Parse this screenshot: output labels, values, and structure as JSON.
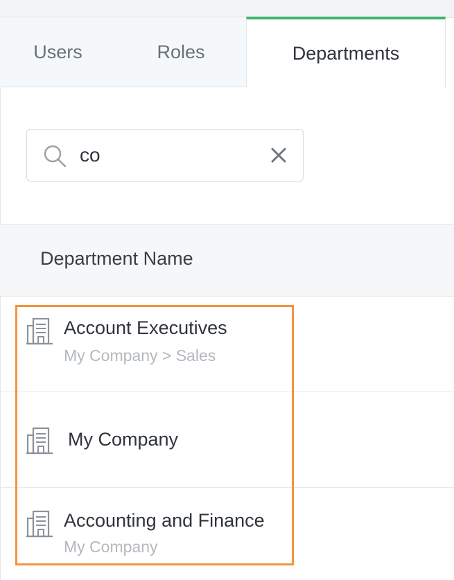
{
  "tabs": [
    {
      "label": "Users",
      "active": false
    },
    {
      "label": "Roles",
      "active": false
    },
    {
      "label": "Departments",
      "active": true
    }
  ],
  "search": {
    "value": "co",
    "placeholder": ""
  },
  "table": {
    "column_header": "Department Name",
    "rows": [
      {
        "name": "Account Executives",
        "path": "My Company > Sales",
        "icon": "building-icon"
      },
      {
        "name": "My Company",
        "path": "",
        "icon": "building-icon"
      },
      {
        "name": "Accounting and Finance",
        "path": "My Company",
        "icon": "building-icon"
      }
    ]
  },
  "colors": {
    "active_tab_accent": "#3bb56a",
    "selection_outline": "#f5933b"
  }
}
